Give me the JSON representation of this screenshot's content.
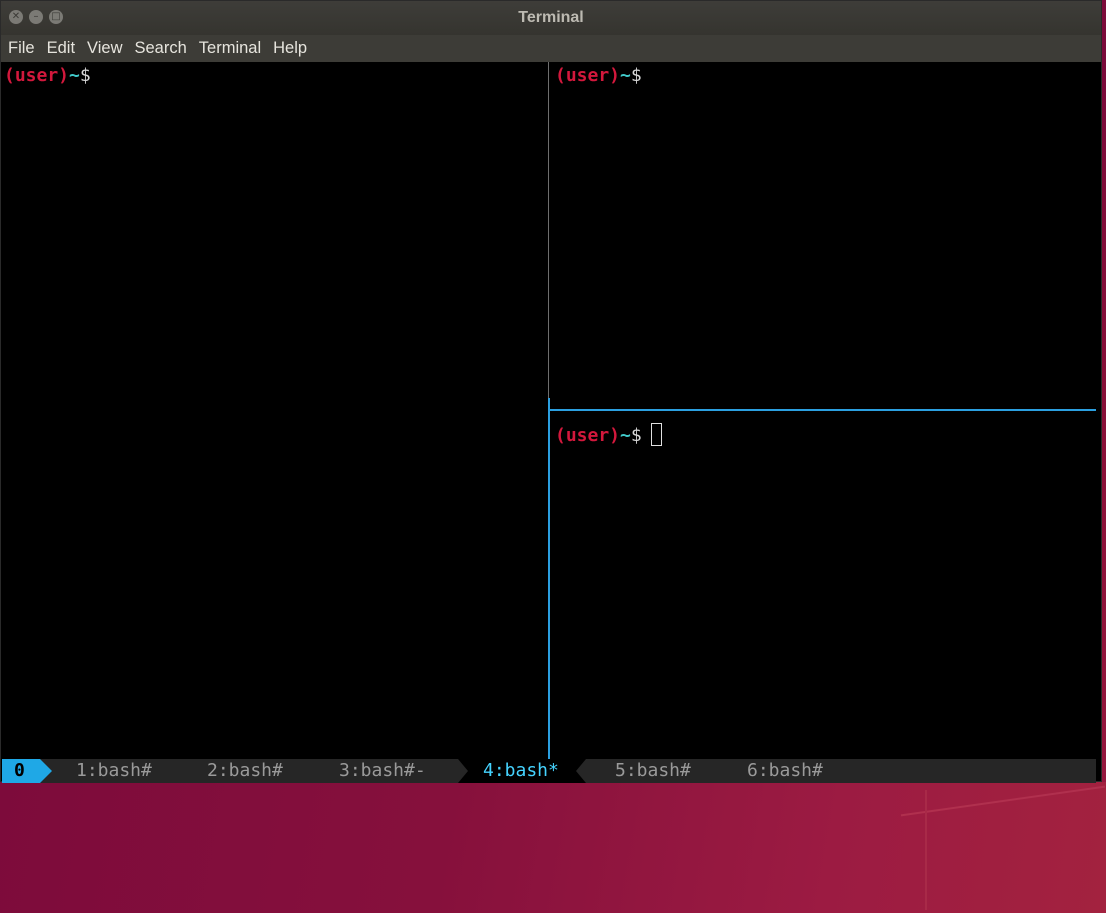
{
  "window": {
    "title": "Terminal"
  },
  "menu": {
    "items": [
      "File",
      "Edit",
      "View",
      "Search",
      "Terminal",
      "Help"
    ]
  },
  "panes": [
    {
      "id": "left",
      "prompt": {
        "user": "(user)",
        "tilde": "~",
        "dollar": "$"
      }
    },
    {
      "id": "top-right",
      "prompt": {
        "user": "(user)",
        "tilde": "~",
        "dollar": "$"
      }
    },
    {
      "id": "bottom-right",
      "prompt": {
        "user": "(user)",
        "tilde": "~",
        "dollar": "$"
      },
      "has_cursor": true
    }
  ],
  "tmux": {
    "session": "0",
    "windows": [
      "1:bash#",
      "2:bash#",
      "3:bash#-",
      "4:bash*",
      "5:bash#",
      "6:bash#"
    ],
    "active_window": "4:bash*"
  },
  "colors": {
    "prompt_user": "#d2183c",
    "prompt_tilde": "#40c8c8",
    "active_border": "#2b9fe0",
    "session_bg": "#1fa8e6",
    "active_tab": "#45d3ff"
  }
}
